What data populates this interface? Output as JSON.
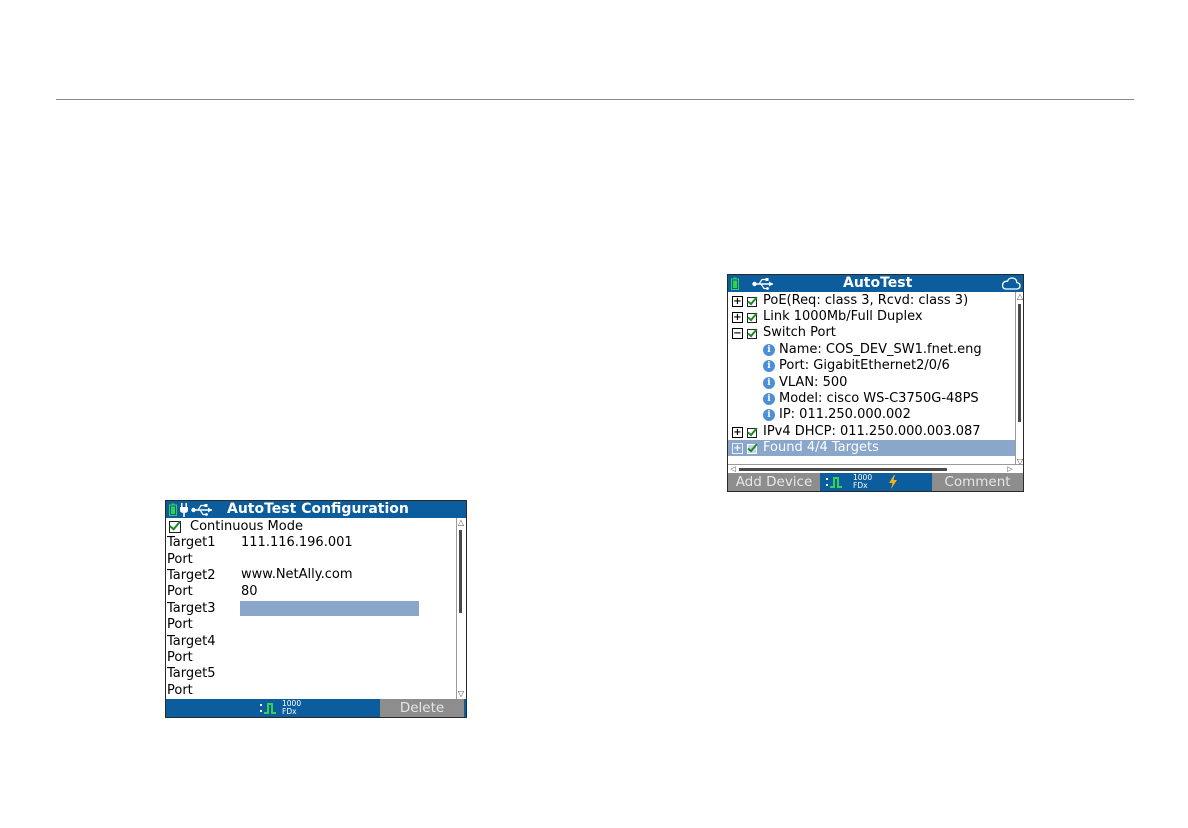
{
  "config_screen": {
    "title": "AutoTest Configuration",
    "continuous_mode_label": "Continuous Mode",
    "continuous_mode_checked": true,
    "rows": [
      {
        "label": "Target1",
        "value": "111.116.196.001"
      },
      {
        "label": "Port",
        "value": ""
      },
      {
        "label": "Target2",
        "value": "www.NetAlly.com"
      },
      {
        "label": "Port",
        "value": "80"
      },
      {
        "label": "Target3",
        "value": ""
      },
      {
        "label": "Port",
        "value": ""
      },
      {
        "label": "Target4",
        "value": ""
      },
      {
        "label": "Port",
        "value": ""
      },
      {
        "label": "Target5",
        "value": ""
      },
      {
        "label": "Port",
        "value": ""
      }
    ],
    "link_speed": "1000",
    "link_duplex": "FDx",
    "delete_label": "Delete"
  },
  "autotest_screen": {
    "title": "AutoTest",
    "items": [
      {
        "label": "PoE(Req: class 3, Rcvd: class 3)"
      },
      {
        "label": "Link 1000Mb/Full Duplex"
      },
      {
        "label": "Switch Port"
      },
      {
        "label": "Name: COS_DEV_SW1.fnet.eng"
      },
      {
        "label": "Port: GigabitEthernet2/0/6"
      },
      {
        "label": "VLAN: 500"
      },
      {
        "label": "Model: cisco WS-C3750G-48PS"
      },
      {
        "label": "IP:  011.250.000.002"
      },
      {
        "label": "IPv4 DHCP:  011.250.000.003.087"
      },
      {
        "label": "Found 4/4 Targets"
      }
    ],
    "add_device_label": "Add Device",
    "comment_label": "Comment",
    "link_speed": "1000",
    "link_duplex": "FDx"
  },
  "colors": {
    "title_bar": "#0c5d9d",
    "selection": "#8aa6cb",
    "softkey_gray": "#8d8d8d",
    "check_green": "#1d8a2a",
    "info_blue": "#4d8fd6"
  },
  "icons": [
    "battery-icon",
    "power-plug-icon",
    "usb-icon",
    "cloud-icon",
    "link-pulse-icon",
    "lightning-icon",
    "info-icon"
  ]
}
